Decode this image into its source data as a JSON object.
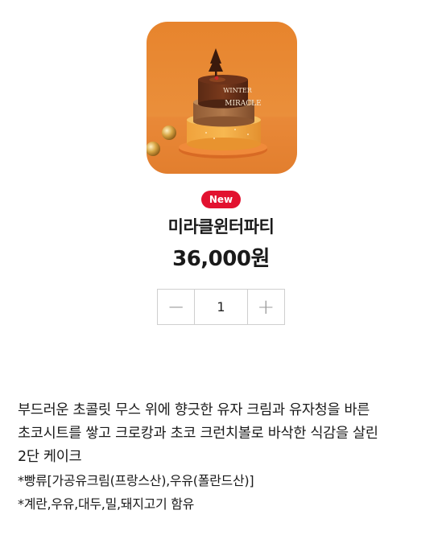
{
  "product": {
    "badge": "New",
    "name": "미라클윈터파티",
    "price": "36,000원"
  },
  "image": {
    "decoration_text_1": "WINTER",
    "decoration_text_2": "MIRACLE"
  },
  "quantity": {
    "minus_symbol": "−",
    "value": "1",
    "plus_symbol": "+"
  },
  "description": {
    "line1": "부드러운 초콜릿 무스 위에 향긋한 유자 크림과 유자청을 바른",
    "line2": "초코시트를 쌓고 크로캉과 초코 크런치볼로 바삭한 식감을 살린",
    "line3": "2단 케이크",
    "note1": "*빵류[가공유크림(프랑스산),우유(폴란드산)]",
    "note2": "*계란,우유,대두,밀,돼지고기 함유"
  },
  "colors": {
    "badge": "#e2112f",
    "image_background": "#e88a34"
  }
}
